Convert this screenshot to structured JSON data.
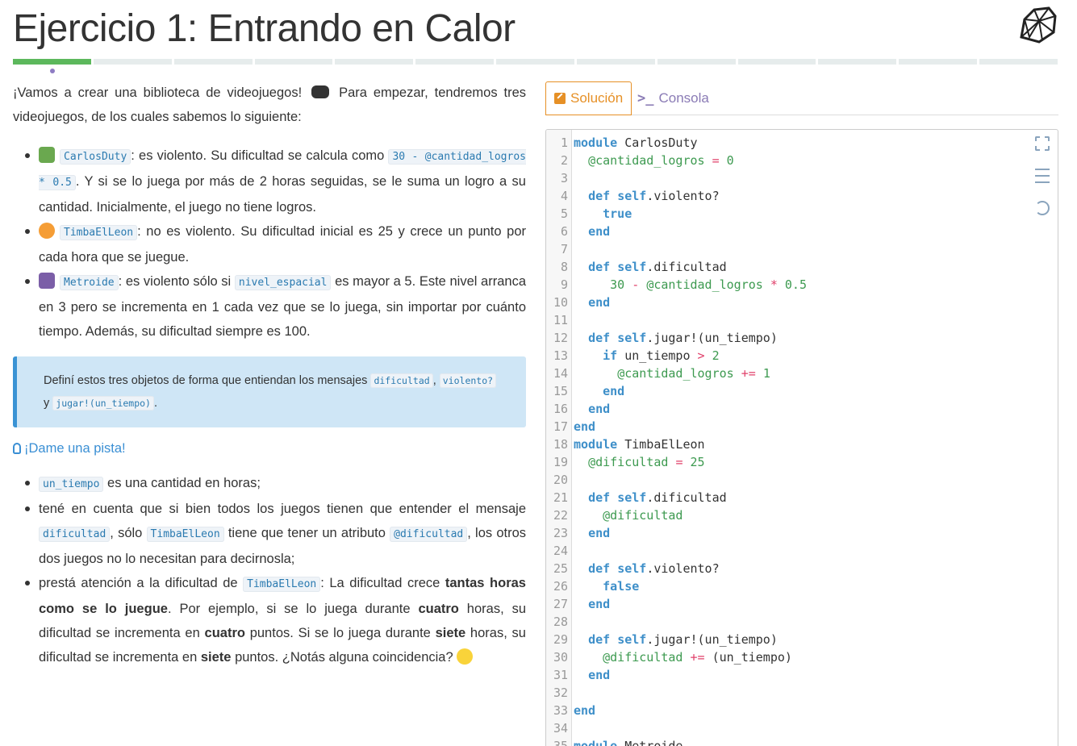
{
  "header": {
    "title": "Ejercicio 1: Entrando en Calor",
    "progress_segments": 13,
    "progress_active_index": 0
  },
  "statement": {
    "intro_before": "¡Vamos a crear una biblioteca de videojuegos!",
    "intro_after": "Para empezar, tendremos tres videojuegos, de los cuales sabemos lo siguiente:",
    "items": [
      {
        "code": "CarlosDuty",
        "t1": ": es violento. Su dificultad se calcula como ",
        "code2": "30 - @cantidad_logros * 0.5",
        "t2": ". Y si se lo juega por más de 2 horas seguidas, se le suma un logro a su cantidad. Inicialmente, el juego no tiene logros."
      },
      {
        "code": "TimbaElLeon",
        "t1": ": no es violento. Su dificultad inicial es 25 y crece un punto por cada hora que se juegue."
      },
      {
        "code": "Metroide",
        "t1": ": es violento sólo si ",
        "code2": "nivel_espacial",
        "t2": " es mayor a 5. Este nivel arranca en 3 pero se incrementa en 1 cada vez que se lo juega, sin importar por cuánto tiempo. Además, su dificultad siempre es 100."
      }
    ]
  },
  "callout": {
    "text": "Definí estos tres objetos de forma que entiendan los mensajes",
    "code1": "dificultad",
    "sep": ",",
    "code2": "violento?",
    "and": "y",
    "code3": "jugar!(un_tiempo)",
    "end": "."
  },
  "hint": {
    "label": "¡Dame una pista!",
    "items": {
      "i1_code": "un_tiempo",
      "i1_text": " es una cantidad en horas;",
      "i2_a": "tené en cuenta que si bien todos los juegos tienen que entender el mensaje ",
      "i2_code1": "dificultad",
      "i2_b": ", sólo ",
      "i2_code2": "TimbaElLeon",
      "i2_c": " tiene que tener un atributo ",
      "i2_code3": "@dificultad",
      "i2_d": ", los otros dos juegos no lo necesitan para decirnosla;",
      "i3_a": "prestá atención a la dificultad de ",
      "i3_code": "TimbaElLeon",
      "i3_b": ": La dificultad crece ",
      "i3_bold1": "tantas horas como se lo juegue",
      "i3_c": ". Por ejemplo, si se lo juega durante ",
      "i3_bold2": "cuatro",
      "i3_d": " horas, su dificultad se incrementa en ",
      "i3_bold3": "cuatro",
      "i3_e": " puntos. Si se lo juega durante ",
      "i3_bold4": "siete",
      "i3_f": " horas, su dificultad se incrementa en ",
      "i3_bold5": "siete",
      "i3_g": " puntos. ¿Notás alguna coincidencia?"
    }
  },
  "tabs": {
    "solution": "Solución",
    "console": "Consola"
  },
  "editor": {
    "lines": [
      "1",
      "2",
      "3",
      "4",
      "5",
      "6",
      "7",
      "8",
      "9",
      "10",
      "11",
      "12",
      "13",
      "14",
      "15",
      "16",
      "17",
      "18",
      "19",
      "20",
      "21",
      "22",
      "23",
      "24",
      "25",
      "26",
      "27",
      "28",
      "29",
      "30",
      "31",
      "32",
      "33",
      "34",
      "35"
    ]
  }
}
